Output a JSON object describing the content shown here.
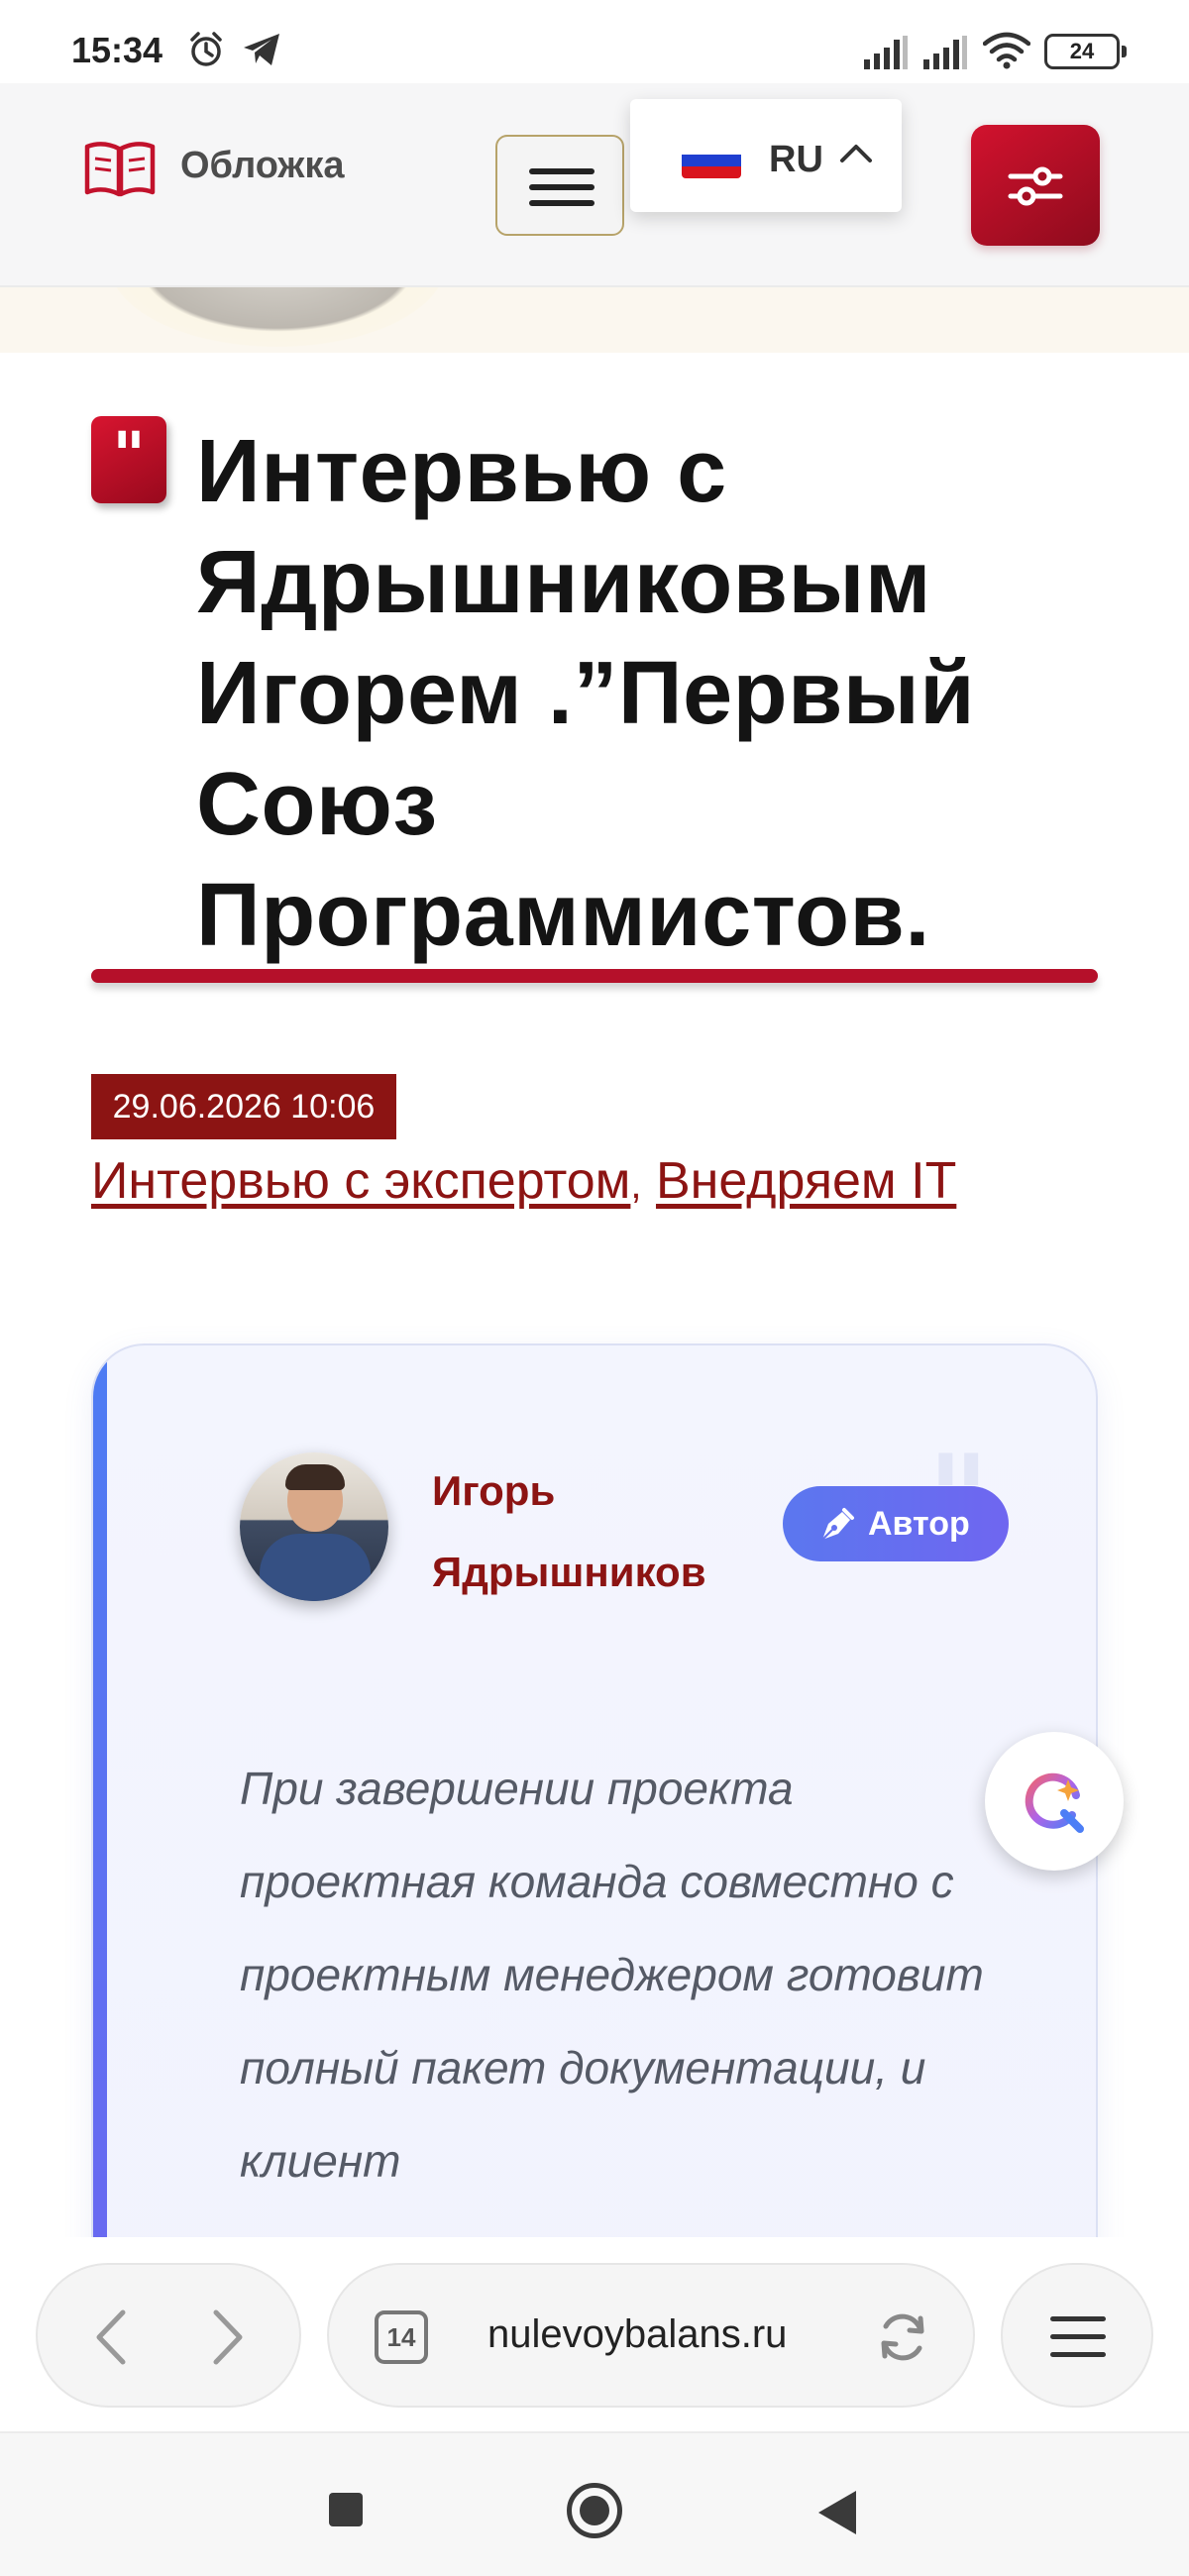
{
  "status_bar": {
    "time": "15:34",
    "battery": "24",
    "icons": [
      "alarm-icon",
      "telegram-icon",
      "signal-icon",
      "signal-icon",
      "wifi-icon",
      "battery-icon"
    ]
  },
  "header": {
    "logo_text": "Обложка",
    "logo_icon": "open-book-icon",
    "menu_icon": "hamburger-icon",
    "language": "RU",
    "language_flag": "russia-flag",
    "filter_icon": "sliders-icon",
    "accent_color": "#b5102a"
  },
  "article": {
    "quote_mark": "\"",
    "title": "Интервью с Ядрышниковым Игорем .”Первый Союз Программистов.",
    "date": "29.06.2026 10:06",
    "categories": [
      {
        "label": "Интервью с экспертом"
      },
      {
        "label": "Внедряем IT"
      }
    ],
    "category_separator": ","
  },
  "author_card": {
    "name": "Игорь Ядрышников",
    "badge_label": "Автор",
    "badge_icon": "pen-nib-icon",
    "quote_text": "При завершении проекта проектная команда совместно с проектным менеджером готовит полный пакет документации, и клиент"
  },
  "chat_widget": {
    "icon": "chat-assistant-icon"
  },
  "browser": {
    "tab_count": "14",
    "url": "nulevoybalans.ru",
    "icons": [
      "back-arrow-icon",
      "forward-arrow-icon",
      "reload-icon",
      "menu-icon"
    ]
  },
  "android_nav": {
    "icons": [
      "recents-icon",
      "home-icon",
      "back-icon"
    ]
  }
}
